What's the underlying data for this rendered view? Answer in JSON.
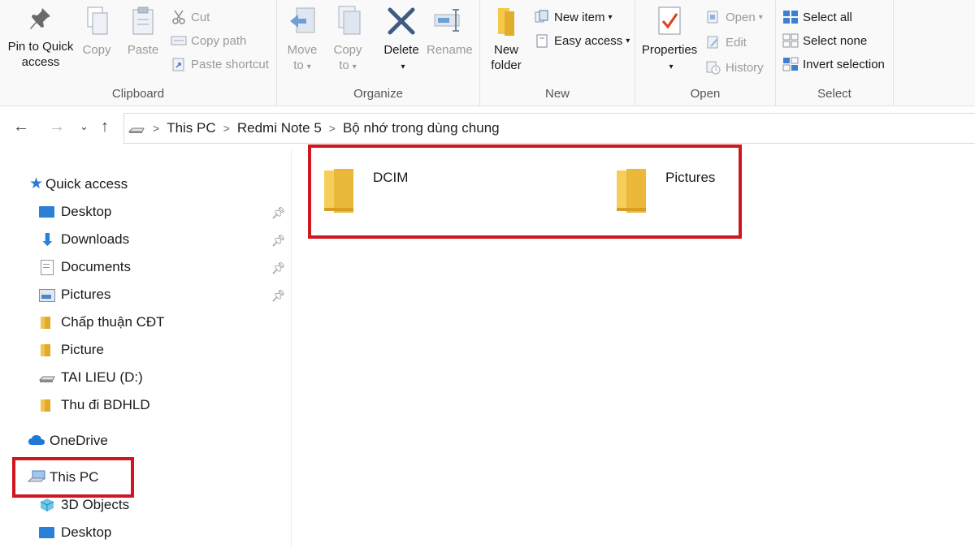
{
  "ribbon": {
    "clipboard": {
      "label": "Clipboard",
      "pin_label_1": "Pin to Quick",
      "pin_label_2": "access",
      "copy_label": "Copy",
      "paste_label": "Paste",
      "cut_label": "Cut",
      "copy_path_label": "Copy path",
      "paste_shortcut_label": "Paste shortcut"
    },
    "organize": {
      "label": "Organize",
      "move_label_1": "Move",
      "move_label_2": "to",
      "copy_label_1": "Copy",
      "copy_label_2": "to",
      "delete_label": "Delete",
      "rename_label": "Rename"
    },
    "new": {
      "label": "New",
      "new_folder_1": "New",
      "new_folder_2": "folder",
      "new_item_label": "New item",
      "easy_access_label": "Easy access"
    },
    "open": {
      "label": "Open",
      "properties_label": "Properties",
      "open_label": "Open",
      "edit_label": "Edit",
      "history_label": "History"
    },
    "select": {
      "label": "Select",
      "select_all_label": "Select all",
      "select_none_label": "Select none",
      "invert_label": "Invert selection"
    }
  },
  "address": {
    "crumbs": [
      "This PC",
      "Redmi Note 5",
      "Bộ nhớ trong dùng chung"
    ]
  },
  "sidebar": {
    "quick_access": "Quick access",
    "items": [
      {
        "label": "Desktop",
        "icon": "desktop-icon",
        "pinned": true
      },
      {
        "label": "Downloads",
        "icon": "downloads-icon",
        "pinned": true
      },
      {
        "label": "Documents",
        "icon": "documents-icon",
        "pinned": true
      },
      {
        "label": "Pictures",
        "icon": "pictures-icon",
        "pinned": true
      },
      {
        "label": "Chấp thuận CĐT",
        "icon": "folder-icon",
        "pinned": false
      },
      {
        "label": "Picture",
        "icon": "folder-icon",
        "pinned": false
      },
      {
        "label": "TAI LIEU (D:)",
        "icon": "drive-icon",
        "pinned": false
      },
      {
        "label": "Thu đi BDHLD",
        "icon": "folder-icon",
        "pinned": false
      }
    ],
    "onedrive": "OneDrive",
    "this_pc": "This PC",
    "this_pc_items": [
      {
        "label": "3D Objects",
        "icon": "3d-objects-icon"
      },
      {
        "label": "Desktop",
        "icon": "desktop-icon"
      }
    ]
  },
  "content": {
    "folders": [
      {
        "name": "DCIM"
      },
      {
        "name": "Pictures"
      }
    ]
  },
  "colors": {
    "highlight": "#d0161e",
    "folder": "#f3c34c",
    "accent": "#1e78d4"
  }
}
